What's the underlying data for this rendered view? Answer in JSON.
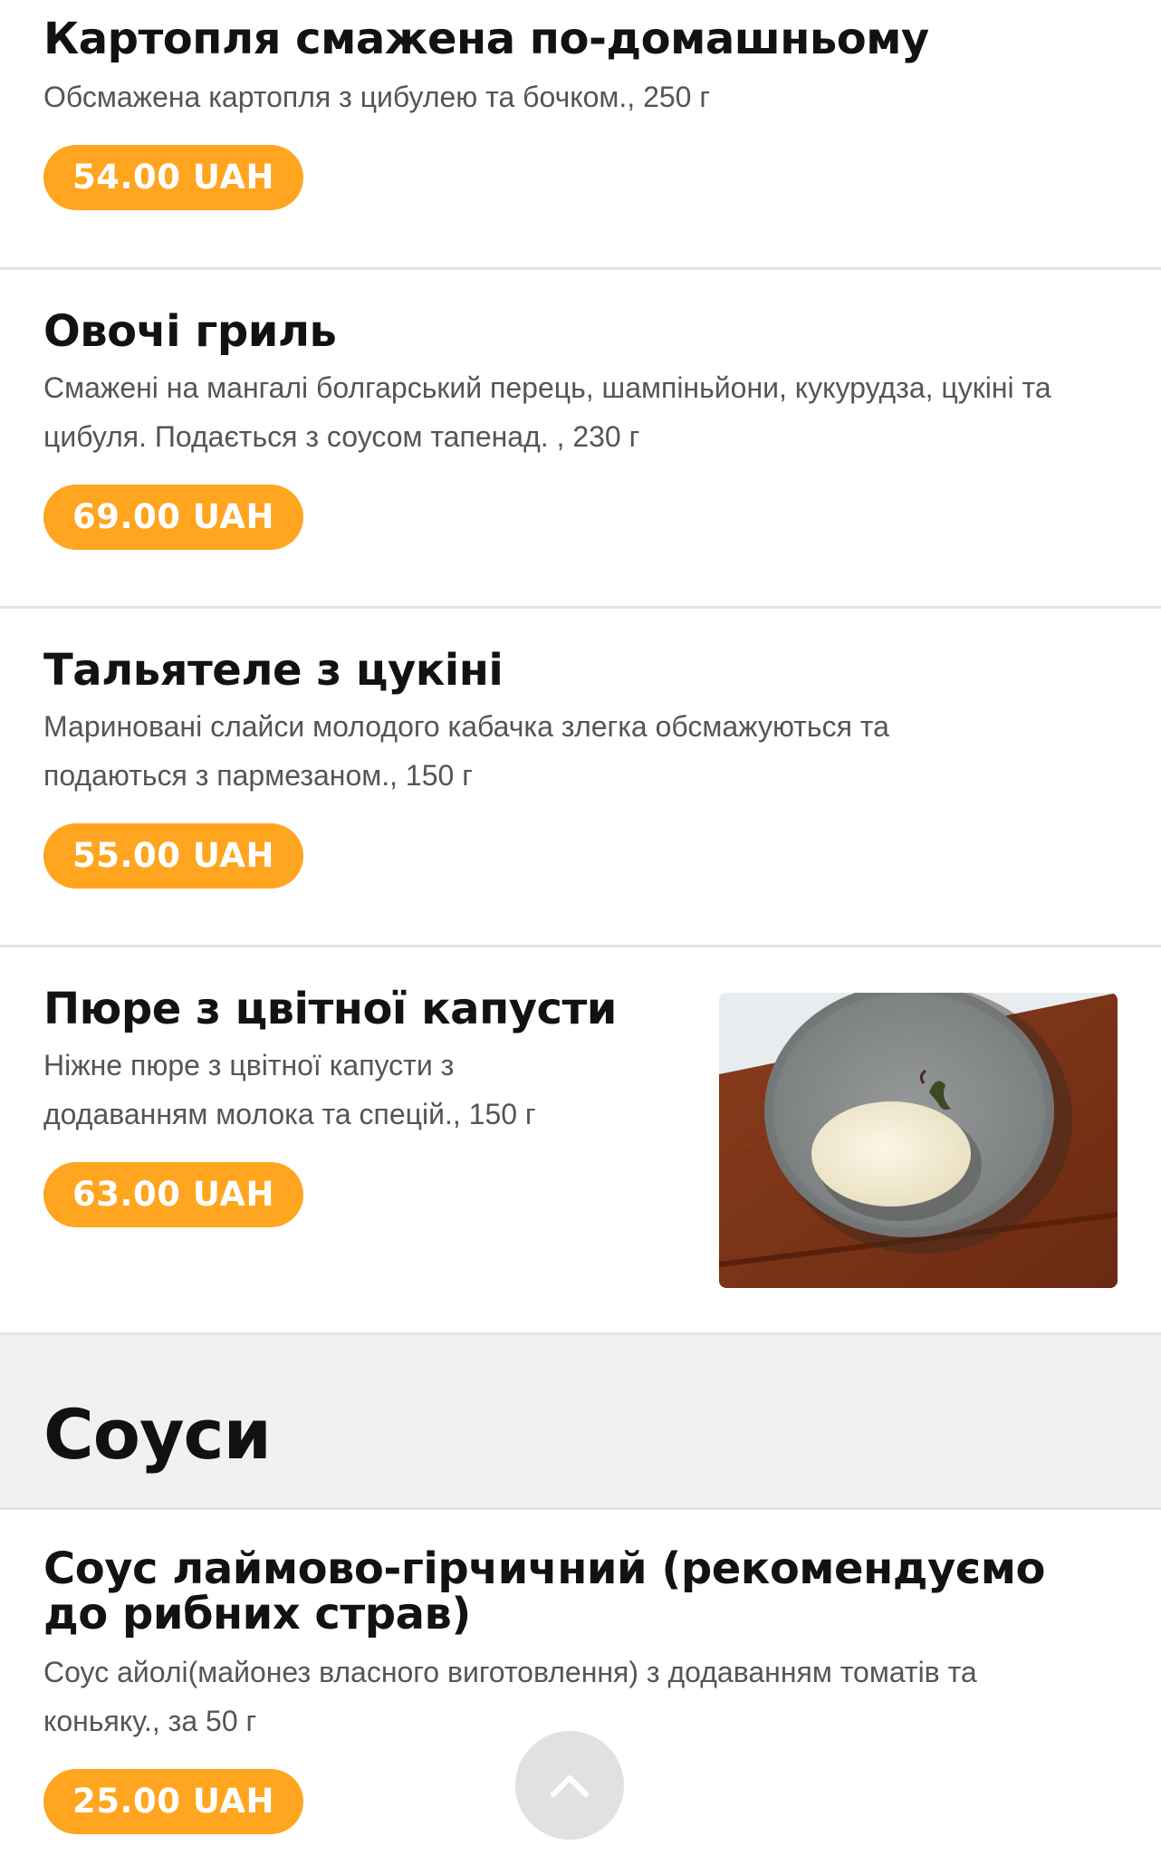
{
  "items": [
    {
      "name": "Картопля смажена по-домашньому",
      "description": "Обсмажена картопля з цибулею та бочком., 250 г",
      "price": "54.00 UAH"
    },
    {
      "name": "Овочі гриль",
      "description": "Смажені на мангалі болгарський перець, шампіньйони, кукурудза, цукіні та цибуля. Подається з соусом тапенад. , 230 г",
      "price": "69.00 UAH"
    },
    {
      "name": "Тальятеле з цукіні",
      "description": "Мариновані слайси молодого кабачка злегка обсмажуються та подаються з пармезаном., 150 г",
      "price": "55.00 UAH"
    },
    {
      "name": "Пюре з цвітної капусти",
      "description": "Ніжне пюре з цвітної капусти з додаванням молока та спецій., 150 г",
      "price": "63.00 UAH"
    }
  ],
  "section": {
    "title": "Соуси"
  },
  "sauce_item": {
    "name": "Соус лаймово-гірчичний (рекомендуємо до рибних страв)",
    "description": "Соус айолі(майонез власного виготовлення) з додаванням томатів та коньяку., за 50 г",
    "price": "25.00 UAH"
  },
  "colors": {
    "price_badge": "#ffa51f",
    "section_bg": "#f1f1f1",
    "divider": "#e3e3e3"
  },
  "icons": {
    "scroll_top": "chevron-up-icon"
  }
}
